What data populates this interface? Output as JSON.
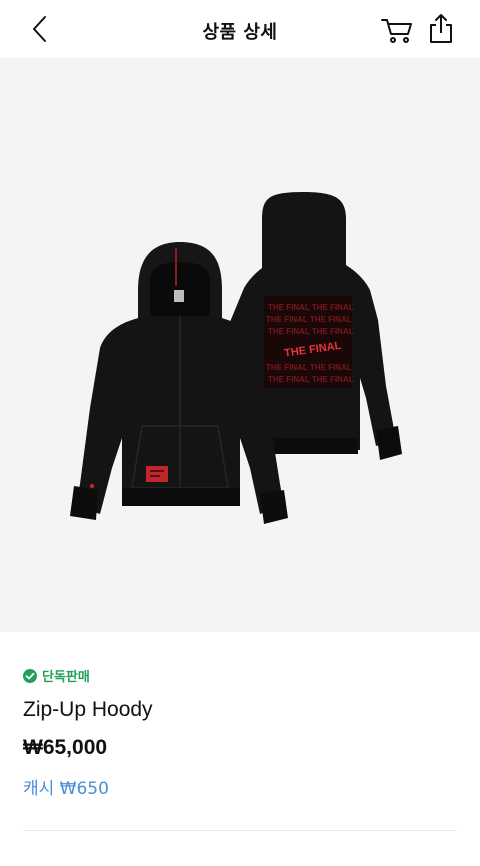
{
  "header": {
    "title": "상품 상세",
    "icons": {
      "back": "chevron-left-icon",
      "cart": "cart-icon",
      "share": "share-icon"
    }
  },
  "product": {
    "badge": "단독판매",
    "name": "Zip-Up Hoody",
    "price": "₩65,000",
    "cash": "캐시 ₩650",
    "print_text": "THE FINAL"
  },
  "colors": {
    "badge_green": "#22a05a",
    "cash_blue": "#4a8fd6",
    "hoodie_black": "#111111",
    "print_red": "#c0272d",
    "hero_bg": "#f4f4f4"
  }
}
